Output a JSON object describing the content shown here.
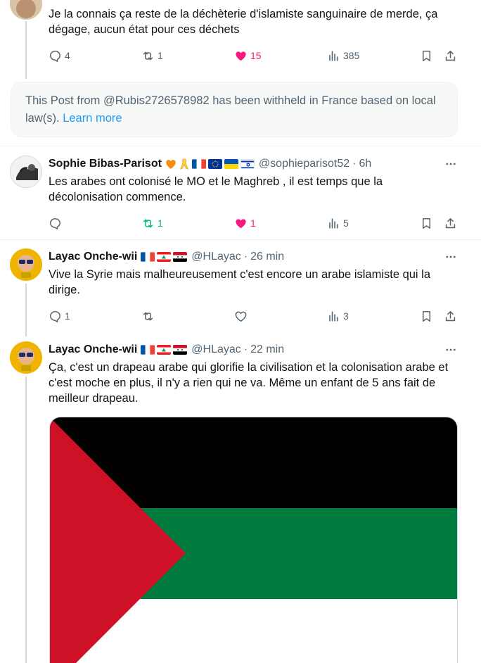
{
  "top_tweet": {
    "text_line1": "Je la connais ça reste de la déchèterie d'islamiste sanguinaire de merde, ça",
    "text_line2": "dégage, aucun état pour ces déchets",
    "replies": "4",
    "reposts": "1",
    "likes": "15",
    "views": "385"
  },
  "withheld_notice": {
    "text": "This Post from @Rubis2726578982 has been withheld in France based on local law(s).",
    "link": "Learn more"
  },
  "tweets": [
    {
      "name": "Sophie Bibas-Parisot",
      "handle": "@sophieparisot52",
      "time": "6h",
      "text": "Les arabes ont colonisé le MO et le Maghreb , il est temps que la décolonisation commence.",
      "replies": "",
      "reposts": "1",
      "likes": "1",
      "views": "5"
    },
    {
      "name": "Layac Onche-wii",
      "handle": "@HLayac",
      "time": "26 min",
      "text": "Vive la Syrie mais malheureusement c'est encore un arabe islamiste qui la dirige.",
      "replies": "1",
      "reposts": "",
      "likes": "",
      "views": "3"
    },
    {
      "name": "Layac Onche-wii",
      "handle": "@HLayac",
      "time": "22 min",
      "text": "Ça, c'est un drapeau arabe qui glorifie la civilisation et la colonisation arabe et c'est moche en plus, il n'y a rien qui ne va. Même un enfant de 5 ans fait de meilleur drapeau."
    }
  ],
  "colors": {
    "accent": "#1d9bf0",
    "like": "#f91880",
    "repost": "#00ba7c",
    "muted": "#536471"
  },
  "icons": [
    "reply-icon",
    "repost-icon",
    "like-icon",
    "views-icon",
    "bookmark-icon",
    "share-icon",
    "more-icon"
  ]
}
